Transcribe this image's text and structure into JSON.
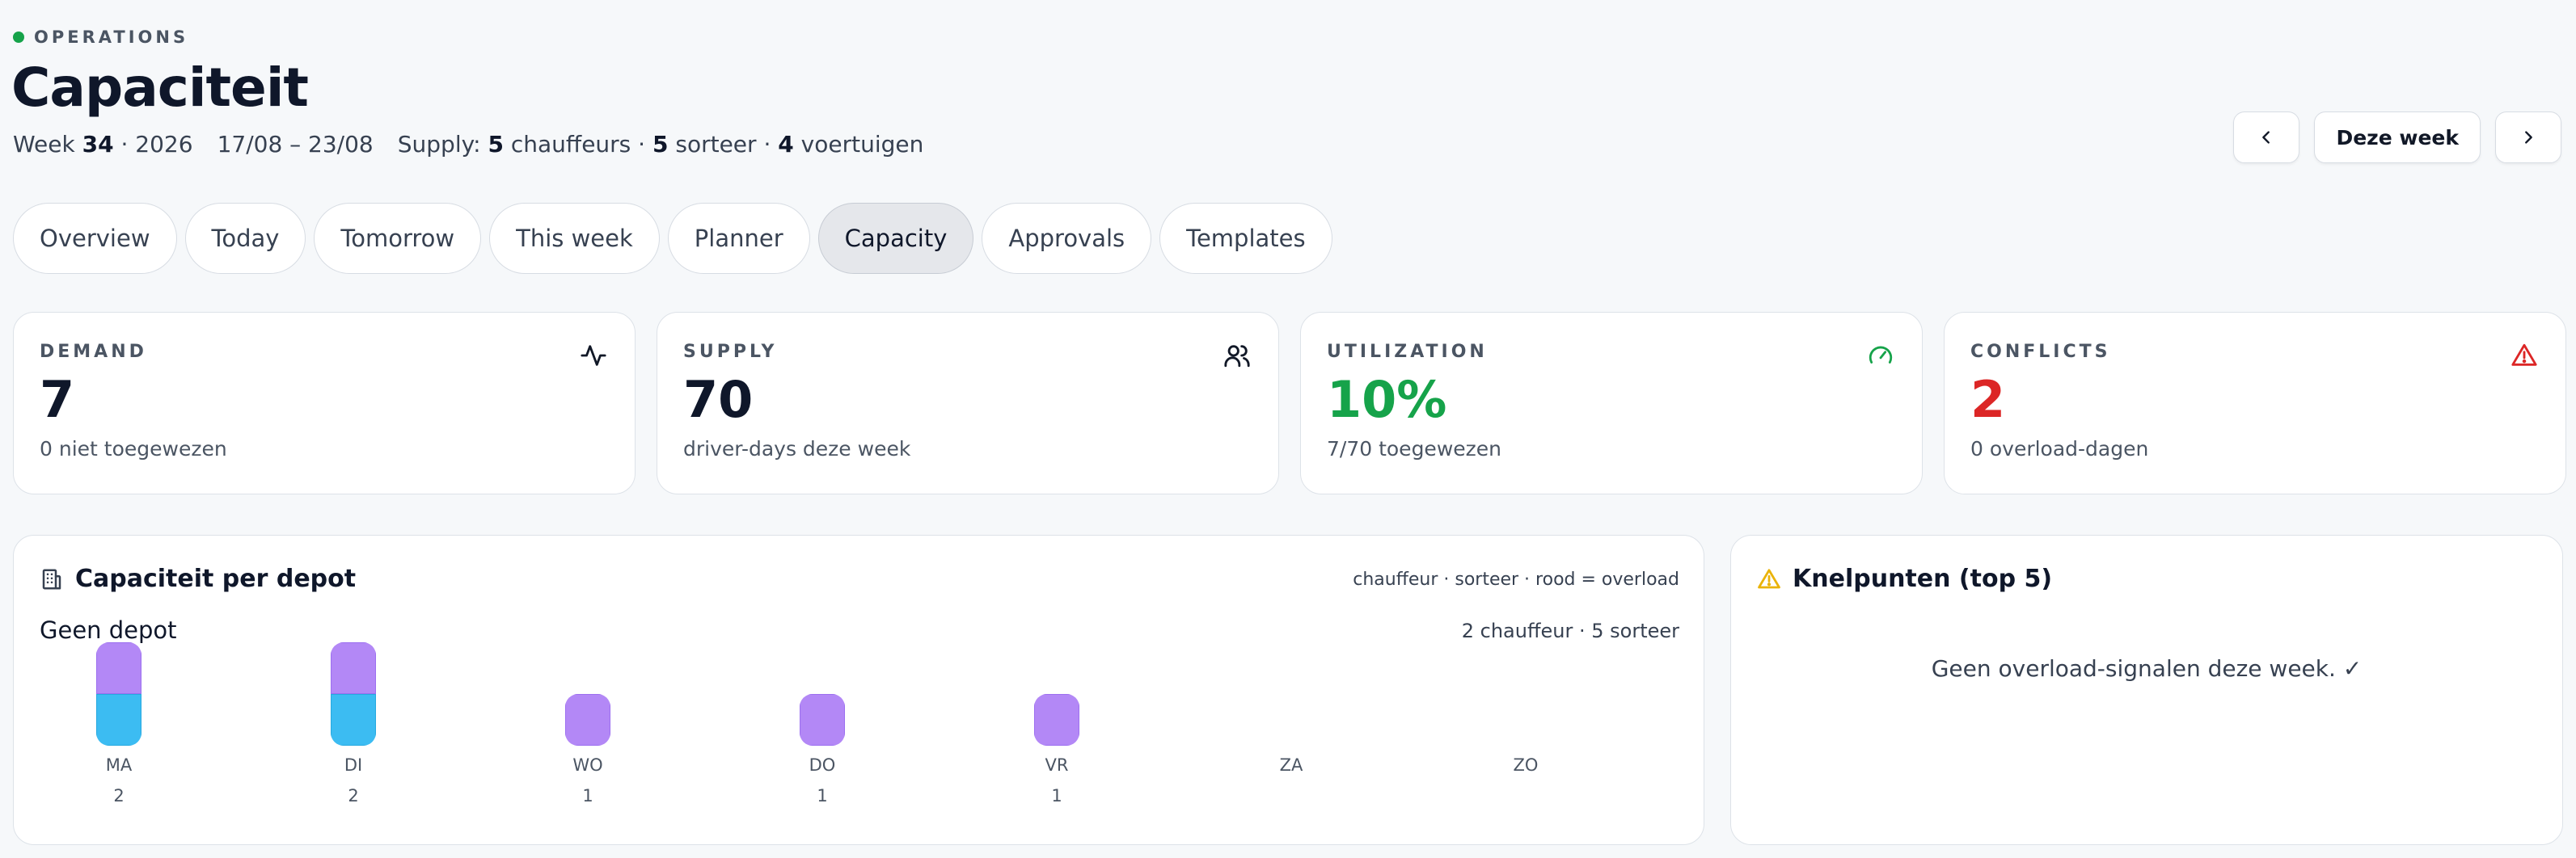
{
  "header": {
    "eyebrow": "OPERATIONS",
    "title": "Capaciteit",
    "week_prefix": "Week",
    "week_number": "34",
    "year": "· 2026",
    "range": "17/08 – 23/08",
    "supply_prefix": "Supply:",
    "chauffeurs_count": "5",
    "chauffeurs_label": "chauffeurs ·",
    "sorteer_count": "5",
    "sorteer_label": "sorteer ·",
    "voertuigen_count": "4",
    "voertuigen_label": "voertuigen"
  },
  "nav": {
    "prev_icon": "chevron-left-icon",
    "this_week_label": "Deze week",
    "next_icon": "chevron-right-icon"
  },
  "tabs": [
    {
      "label": "Overview"
    },
    {
      "label": "Today"
    },
    {
      "label": "Tomorrow"
    },
    {
      "label": "This week"
    },
    {
      "label": "Planner"
    },
    {
      "label": "Capacity",
      "active": true
    },
    {
      "label": "Approvals"
    },
    {
      "label": "Templates"
    }
  ],
  "kpis": {
    "demand": {
      "label": "DEMAND",
      "value": "7",
      "sub": "0 niet toegewezen",
      "icon": "activity-icon"
    },
    "supply": {
      "label": "SUPPLY",
      "value": "70",
      "sub": "driver-days deze week",
      "icon": "users-icon"
    },
    "utilization": {
      "label": "UTILIZATION",
      "value": "10%",
      "sub": "7/70 toegewezen",
      "icon": "gauge-icon",
      "color": "#16a34a"
    },
    "conflicts": {
      "label": "CONFLICTS",
      "value": "2",
      "sub": "0 overload-dagen",
      "icon": "alert-triangle-icon",
      "color": "#dc2626"
    }
  },
  "depot_panel": {
    "title": "Capaciteit per depot",
    "icon": "building-icon",
    "legend": "chauffeur · sorteer · rood = overload",
    "depot_name": "Geen depot",
    "summary": "2 chauffeur · 5 sorteer",
    "days": [
      {
        "label": "MA",
        "count": "2",
        "chauffeur": 1,
        "sorteer": 1
      },
      {
        "label": "DI",
        "count": "2",
        "chauffeur": 1,
        "sorteer": 1
      },
      {
        "label": "WO",
        "count": "1",
        "chauffeur": 0,
        "sorteer": 1
      },
      {
        "label": "DO",
        "count": "1",
        "chauffeur": 0,
        "sorteer": 1
      },
      {
        "label": "VR",
        "count": "1",
        "chauffeur": 0,
        "sorteer": 1
      },
      {
        "label": "ZA",
        "count": "",
        "chauffeur": 0,
        "sorteer": 0
      },
      {
        "label": "ZO",
        "count": "",
        "chauffeur": 0,
        "sorteer": 0
      }
    ],
    "colors": {
      "chauffeur": "#3cbcf2",
      "sorteer": "#b388f6"
    }
  },
  "knelpunten_panel": {
    "title": "Knelpunten (top 5)",
    "icon": "warning-icon",
    "empty_message": "Geen overload-signalen deze week. ✓"
  }
}
